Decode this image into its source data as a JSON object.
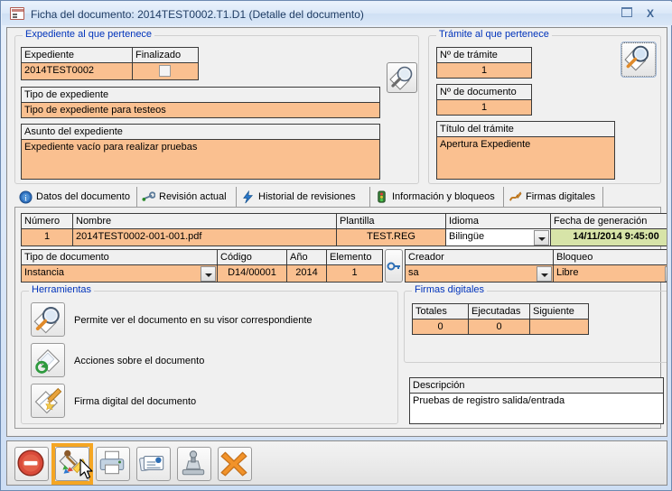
{
  "window": {
    "title": "Ficha del documento: 2014TEST0002.T1.D1 (Detalle del documento)",
    "icon": "form-icon",
    "minimize_label": "",
    "close_label": "X"
  },
  "expediente_group": {
    "legend": "Expediente al que pertenece",
    "fields": {
      "expediente_label": "Expediente",
      "expediente_value": "2014TEST0002",
      "finalizado_label": "Finalizado",
      "finalizado_checked": false,
      "tipo_label": "Tipo de expediente",
      "tipo_value": "Tipo de expediente para testeos",
      "asunto_label": "Asunto del expediente",
      "asunto_value": "Expediente vacío para realizar pruebas"
    },
    "search_button": "search-expediente-button"
  },
  "tramite_group": {
    "legend": "Trámite al que pertenece",
    "fields": {
      "num_tramite_label": "Nº de trámite",
      "num_tramite_value": "1",
      "num_documento_label": "Nº de documento",
      "num_documento_value": "1",
      "titulo_label": "Título del trámite",
      "titulo_value": "Apertura Expediente"
    },
    "search_button": "search-tramite-button"
  },
  "tabs": [
    {
      "label": "Datos del documento",
      "icon": "info-circle-icon",
      "active": true
    },
    {
      "label": "Revisión actual",
      "icon": "wrench-icon",
      "active": false
    },
    {
      "label": "Historial de revisiones",
      "icon": "lightning-icon",
      "active": false
    },
    {
      "label": "Información y bloqueos",
      "icon": "traffic-light-icon",
      "active": false
    },
    {
      "label": "Firmas digitales",
      "icon": "signature-icon",
      "active": false
    }
  ],
  "doc_grid": {
    "headers": [
      "Número",
      "Nombre",
      "Plantilla",
      "Idioma",
      "Fecha de generación"
    ],
    "row": {
      "numero": "1",
      "nombre": "2014TEST0002-001-001.pdf",
      "plantilla": "TEST.REG",
      "idioma": "Bilingüe",
      "fecha": "14/11/2014 9:45:00"
    }
  },
  "doc_grid2": {
    "headers": [
      "Tipo de documento",
      "Código",
      "Año",
      "Elemento",
      "Creador",
      "Bloqueo"
    ],
    "row": {
      "tipo_documento": "Instancia",
      "codigo": "D14/00001",
      "anio": "2014",
      "elemento": "1",
      "creador": "sa",
      "bloqueo": "Libre"
    },
    "key_button": "key-icon-button"
  },
  "herramientas": {
    "legend": "Herramientas",
    "items": [
      {
        "icon": "magnifier-document-icon",
        "label": "Permite ver el documento en su visor correspondiente"
      },
      {
        "icon": "document-refresh-icon",
        "label": "Acciones sobre el documento"
      },
      {
        "icon": "signature-pen-icon",
        "label": "Firma digital del documento"
      }
    ]
  },
  "firmas": {
    "legend": "Firmas digitales",
    "headers": [
      "Totales",
      "Ejecutadas",
      "Siguiente"
    ],
    "values": [
      "0",
      "0",
      ""
    ]
  },
  "descripcion": {
    "label": "Descripción",
    "value": "Pruebas de registro salida/entrada"
  },
  "bottom_toolbar": {
    "buttons": [
      {
        "name": "cancel-button",
        "icon": "red-minus-circle-icon",
        "selected": false
      },
      {
        "name": "sign-document-button",
        "icon": "pen-palette-icon",
        "selected": true
      },
      {
        "name": "print-button",
        "icon": "printer-icon",
        "selected": false
      },
      {
        "name": "cards-button",
        "icon": "id-cards-icon",
        "selected": false
      },
      {
        "name": "stamp-button",
        "icon": "stamp-icon",
        "selected": false
      },
      {
        "name": "exit-button",
        "icon": "orange-x-icon",
        "selected": false
      }
    ]
  },
  "colors": {
    "field_orange": "#fac090",
    "field_green": "#d7e4a8",
    "legend_blue": "#0033bb",
    "highlight_orange": "#f5a623",
    "title_text": "#1f3c63"
  }
}
